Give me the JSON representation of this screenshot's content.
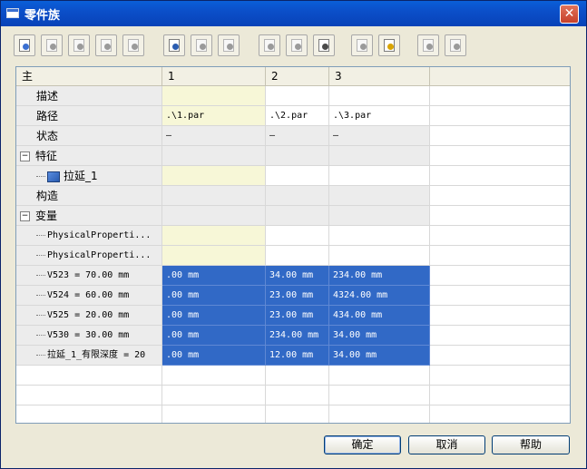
{
  "window": {
    "title": "零件族",
    "close_label": "✕"
  },
  "toolbar": {
    "buttons": [
      {
        "icon": "insert-member-icon",
        "enabled": true,
        "accent": "#3a6fd1"
      },
      {
        "icon": "delete-member-icon",
        "enabled": false,
        "accent": "#9a9a9a"
      },
      {
        "icon": "rename-member-icon",
        "enabled": false,
        "accent": "#9a9a9a"
      },
      {
        "icon": "edit-member-icon",
        "enabled": false,
        "accent": "#9a9a9a"
      },
      {
        "icon": "select-all-icon",
        "enabled": false,
        "accent": "#9a9a9a"
      },
      {
        "icon": "add-variable-icon",
        "enabled": true,
        "accent": "#2a5cb0"
      },
      {
        "icon": "copy-icon",
        "enabled": false,
        "accent": "#9a9a9a"
      },
      {
        "icon": "paste-special-icon",
        "enabled": false,
        "accent": "#9a9a9a"
      },
      {
        "icon": "save-icon",
        "enabled": false,
        "accent": "#9a9a9a"
      },
      {
        "icon": "undo-icon",
        "enabled": false,
        "accent": "#9a9a9a"
      },
      {
        "icon": "print-icon",
        "enabled": true,
        "accent": "#4a4a4a"
      },
      {
        "icon": "copy-cells-icon",
        "enabled": false,
        "accent": "#9a9a9a"
      },
      {
        "icon": "paste-icon",
        "enabled": true,
        "accent": "#d9a400"
      },
      {
        "icon": "zoom-in-icon",
        "enabled": false,
        "accent": "#9a9a9a"
      },
      {
        "icon": "zoom-out-icon",
        "enabled": false,
        "accent": "#9a9a9a"
      }
    ]
  },
  "table": {
    "headers": [
      "主",
      "1",
      "2",
      "3",
      ""
    ],
    "rows": [
      {
        "label": "描述",
        "kind": "text",
        "cells": [
          "",
          "",
          ""
        ]
      },
      {
        "label": "路径",
        "kind": "text",
        "cells": [
          ".\\1.par",
          ".\\2.par",
          ".\\3.par"
        ]
      },
      {
        "label": "状态",
        "kind": "gray",
        "cells": [
          "—",
          "—",
          "—"
        ]
      },
      {
        "label": "特征",
        "kind": "group",
        "expander": "−",
        "cells": [
          "",
          "",
          ""
        ]
      },
      {
        "label": "拉延_1",
        "kind": "feature",
        "cells": [
          "",
          "",
          ""
        ]
      },
      {
        "label": "构造",
        "kind": "gray-plain",
        "cells": [
          "",
          "",
          ""
        ]
      },
      {
        "label": "变量",
        "kind": "group",
        "expander": "−",
        "cells": [
          "",
          "",
          ""
        ]
      },
      {
        "label": "PhysicalProperti...",
        "kind": "var",
        "cells": [
          "",
          "",
          ""
        ]
      },
      {
        "label": "PhysicalProperti...",
        "kind": "var",
        "cells": [
          "",
          "",
          ""
        ]
      },
      {
        "label": "V523 = 70.00 mm",
        "kind": "blue",
        "cells": [
          ".00 mm",
          "34.00 mm",
          "234.00 mm"
        ]
      },
      {
        "label": "V524 = 60.00 mm",
        "kind": "blue",
        "cells": [
          ".00 mm",
          "23.00 mm",
          "4324.00 mm"
        ]
      },
      {
        "label": "V525 = 20.00 mm",
        "kind": "blue",
        "cells": [
          ".00 mm",
          "23.00 mm",
          "434.00 mm"
        ]
      },
      {
        "label": "V530 = 30.00 mm",
        "kind": "blue",
        "cells": [
          ".00 mm",
          "234.00 mm",
          "34.00 mm"
        ]
      },
      {
        "label": "拉延_1_有限深度 = 20",
        "kind": "blue",
        "cells": [
          ".00 mm",
          "12.00 mm",
          "34.00 mm"
        ]
      },
      {
        "label": "",
        "kind": "empty",
        "cells": [
          "",
          "",
          ""
        ]
      },
      {
        "label": "",
        "kind": "empty",
        "cells": [
          "",
          "",
          ""
        ]
      },
      {
        "label": "",
        "kind": "empty",
        "cells": [
          "",
          "",
          ""
        ]
      }
    ]
  },
  "buttons": {
    "ok": "确定",
    "cancel": "取消",
    "help": "帮助"
  }
}
